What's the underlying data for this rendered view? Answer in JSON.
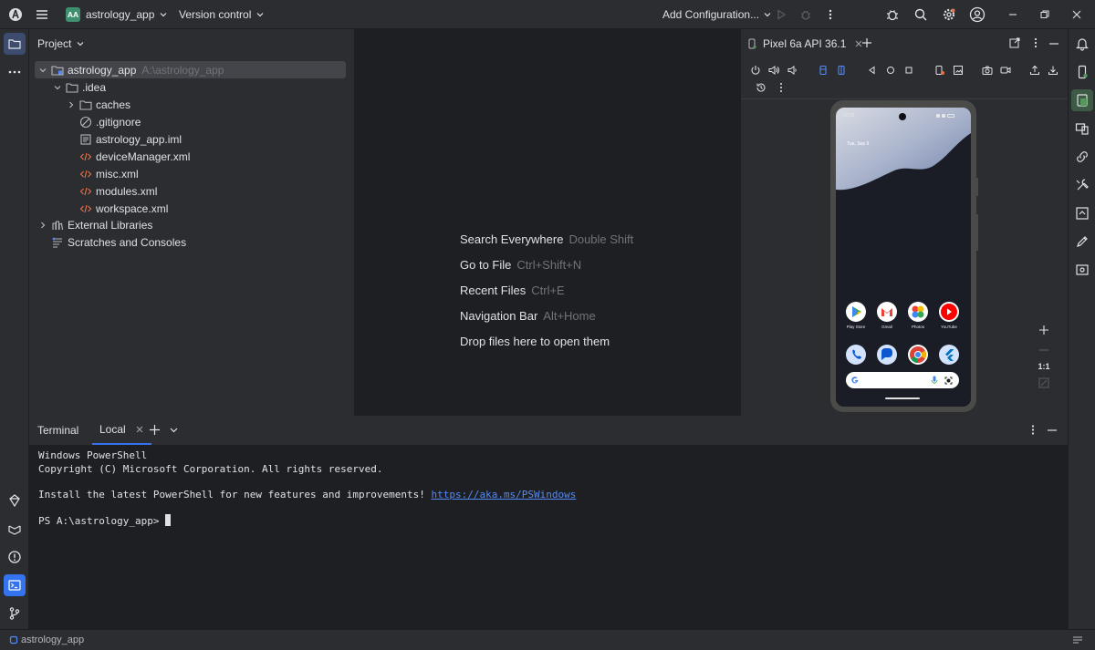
{
  "titlebar": {
    "project_badge": "AA",
    "project_name": "astrology_app",
    "vcs_label": "Version control",
    "run_config": "Add Configuration..."
  },
  "project_panel": {
    "title": "Project",
    "tree": [
      {
        "label": "astrology_app",
        "path": "A:\\astrology_app",
        "kind": "module"
      },
      {
        "label": ".idea",
        "kind": "folder"
      },
      {
        "label": "caches",
        "kind": "folder"
      },
      {
        "label": ".gitignore",
        "kind": "ignore"
      },
      {
        "label": "astrology_app.iml",
        "kind": "iml"
      },
      {
        "label": "deviceManager.xml",
        "kind": "xml"
      },
      {
        "label": "misc.xml",
        "kind": "xml"
      },
      {
        "label": "modules.xml",
        "kind": "xml"
      },
      {
        "label": "workspace.xml",
        "kind": "xml"
      },
      {
        "label": "External Libraries",
        "kind": "libraries"
      },
      {
        "label": "Scratches and Consoles",
        "kind": "scratches"
      }
    ]
  },
  "editor_hints": [
    {
      "action": "Search Everywhere",
      "shortcut": "Double Shift"
    },
    {
      "action": "Go to File",
      "shortcut": "Ctrl+Shift+N"
    },
    {
      "action": "Recent Files",
      "shortcut": "Ctrl+E"
    },
    {
      "action": "Navigation Bar",
      "shortcut": "Alt+Home"
    },
    {
      "action": "Drop files here to open them",
      "shortcut": ""
    }
  ],
  "devices": {
    "tab_label": "Pixel 6a API 36.1",
    "zoom_label": "1:1",
    "phone": {
      "time": "10:25",
      "date": "Tue, Sep 9",
      "apps_row1": [
        "Play Store",
        "Gmail",
        "Photos",
        "YouTube"
      ]
    }
  },
  "terminal": {
    "title": "Terminal",
    "tab_label": "Local",
    "lines": {
      "l1": "Windows PowerShell",
      "l2": "Copyright (C) Microsoft Corporation. All rights reserved.",
      "l3": "Install the latest PowerShell for new features and improvements! ",
      "link": "https://aka.ms/PSWindows",
      "prompt": "PS A:\\astrology_app> "
    }
  },
  "statusbar": {
    "project": "astrology_app"
  },
  "colors": {
    "accent": "#3574f0",
    "xml_icon": "#e8734a",
    "badge": "#3e8f6f"
  }
}
